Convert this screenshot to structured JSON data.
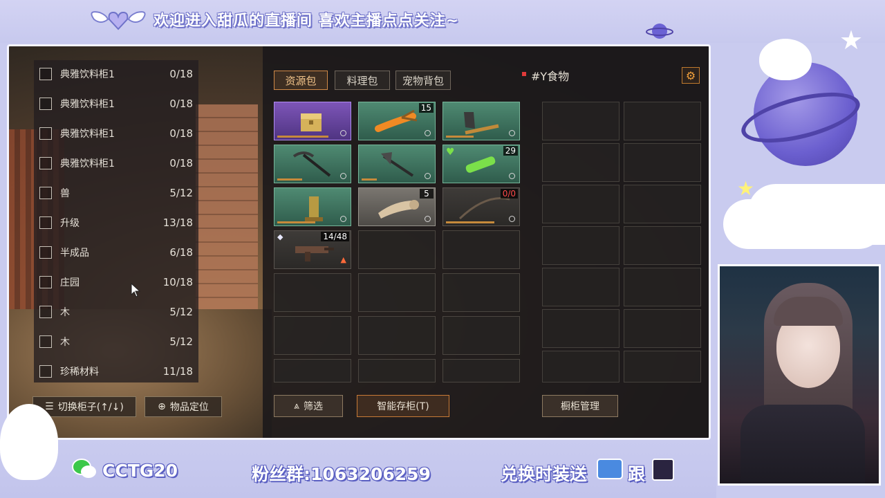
{
  "overlay": {
    "top_banner": "欢迎进入甜瓜的直播间 喜欢主播点点关注~",
    "wechat_id": "CCTG20",
    "fan_group": "粉丝群:1063206259",
    "exchange_text": "兑换时装送",
    "exchange_suffix": "跟"
  },
  "storage_list": {
    "rows": [
      {
        "name": "典雅饮料柜1",
        "count": "0/18"
      },
      {
        "name": "典雅饮料柜1",
        "count": "0/18"
      },
      {
        "name": "典雅饮料柜1",
        "count": "0/18"
      },
      {
        "name": "典雅饮料柜1",
        "count": "0/18"
      },
      {
        "name": "兽",
        "count": "5/12"
      },
      {
        "name": "升级",
        "count": "13/18"
      },
      {
        "name": "半成品",
        "count": "6/18"
      },
      {
        "name": "庄园",
        "count": "10/18"
      },
      {
        "name": "木",
        "count": "5/12"
      },
      {
        "name": "木",
        "count": "5/12"
      },
      {
        "name": "珍稀材料",
        "count": "11/18"
      }
    ],
    "switch_button": "切换柜子(↑/↓)",
    "locate_button": "物品定位"
  },
  "inventory": {
    "tabs": [
      "资源包",
      "料理包",
      "宠物背包"
    ],
    "active_tab": "资源包",
    "slots": [
      {
        "rarity": "purple",
        "icon": "treasure-chest-icon",
        "count": "",
        "durability": 0.8
      },
      {
        "rarity": "green",
        "icon": "slingshot-icon",
        "count": "15",
        "durability": 0
      },
      {
        "rarity": "green",
        "icon": "axe-icon",
        "count": "",
        "durability": 0.45
      },
      {
        "rarity": "green",
        "icon": "pickaxe-icon",
        "count": "",
        "durability": 0.4
      },
      {
        "rarity": "green",
        "icon": "battle-axe-icon",
        "count": "",
        "durability": 0.25
      },
      {
        "rarity": "green",
        "icon": "syringe-icon",
        "count": "29",
        "durability": 0
      },
      {
        "rarity": "green",
        "icon": "lamp-post-icon",
        "count": "",
        "durability": 0.6
      },
      {
        "rarity": "grey",
        "icon": "cloth-roll-icon",
        "count": "5",
        "durability": 0
      },
      {
        "rarity": "dark",
        "icon": "fishing-rod-icon",
        "count": "0/0",
        "durability": 0.75
      },
      {
        "rarity": "dark",
        "icon": "smg-icon",
        "count": "14/48",
        "durability": 0.75
      }
    ],
    "filter_button": "筛选",
    "smart_store_button": "智能存柜(T)"
  },
  "storage_box": {
    "title": "#Y食物",
    "manage_button": "橱柜管理"
  },
  "colors": {
    "accent": "#d08a48",
    "overlay_purple": "#c9cbef",
    "text_outline": "#5a5fc2"
  }
}
